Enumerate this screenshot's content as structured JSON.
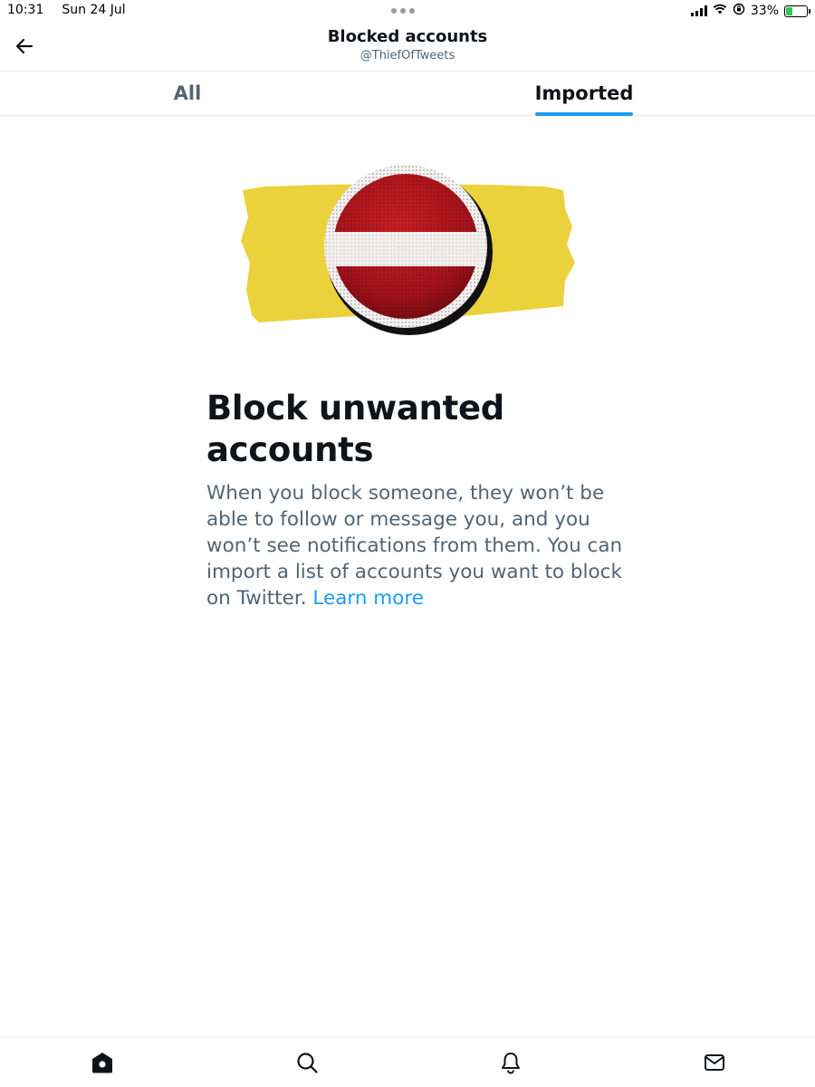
{
  "status_bar": {
    "time": "10:31",
    "date": "Sun 24 Jul",
    "battery_percent": "33%",
    "battery_level": 0.33
  },
  "header": {
    "title": "Blocked accounts",
    "handle": "@ThiefOfTweets"
  },
  "tabs": [
    {
      "label": "All",
      "selected": false
    },
    {
      "label": "Imported",
      "selected": true
    }
  ],
  "empty_state": {
    "headline": "Block unwanted accounts",
    "description": "When you block someone, they won’t be able to follow or message you, and you won’t see notifications from them. You can import a list of accounts you want to block on Twitter. ",
    "link_label": "Learn more"
  },
  "bottom_nav": [
    "home-icon",
    "search-icon",
    "notifications-icon",
    "messages-icon"
  ],
  "colors": {
    "accent": "#1d9bf0",
    "text_primary": "#0f1419",
    "text_secondary": "#536471",
    "illustration_yellow": "#ebd23c",
    "illustration_red": "#b8161c"
  }
}
